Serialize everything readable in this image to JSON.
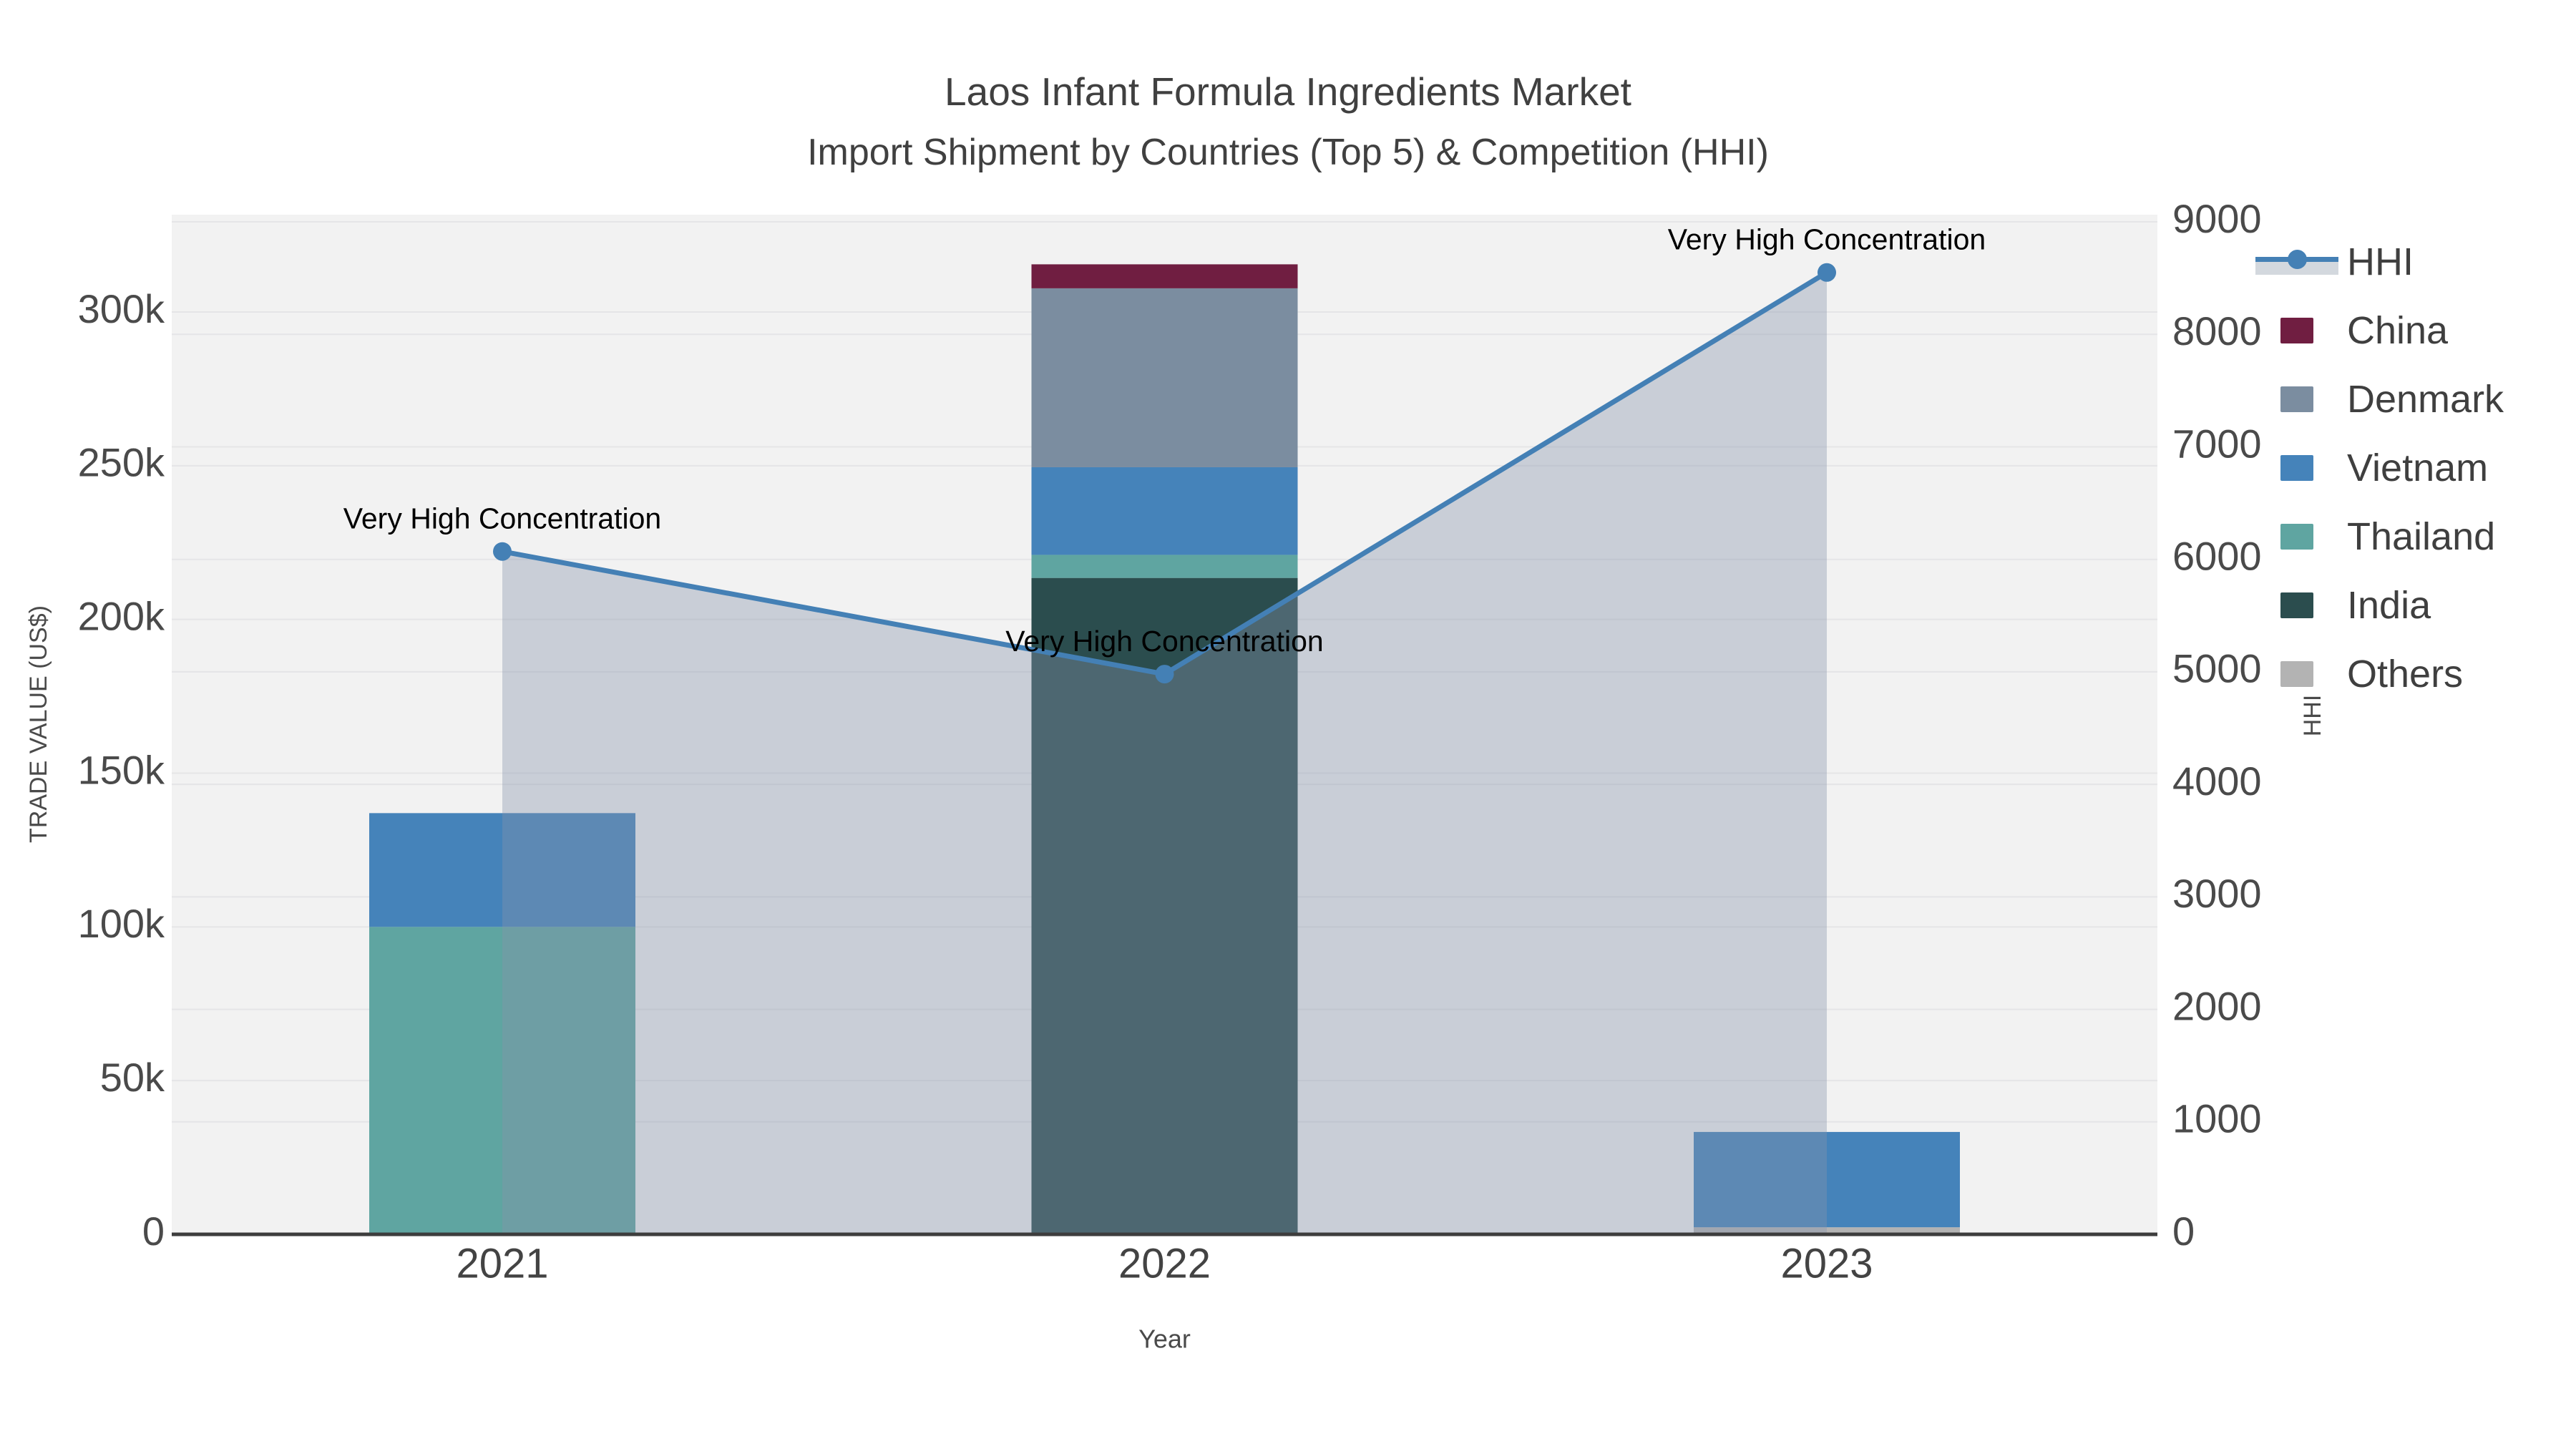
{
  "title": {
    "line1": "Laos Infant Formula Ingredients Market",
    "line2": "Import Shipment by Countries (Top 5) & Competition (HHI)"
  },
  "axes": {
    "x": {
      "label": "Year",
      "ticks": [
        "2021",
        "2022",
        "2023"
      ]
    },
    "y_left": {
      "label": "TRADE VALUE (US$)",
      "ticks": [
        "0",
        "50k",
        "100k",
        "150k",
        "200k",
        "250k",
        "300k"
      ],
      "tick_step": 50000
    },
    "y_right": {
      "label": "HHI",
      "ticks": [
        "0",
        "1000",
        "2000",
        "3000",
        "4000",
        "5000",
        "6000",
        "7000",
        "8000",
        "9000"
      ],
      "tick_step": 1000
    }
  },
  "legend": {
    "items": [
      {
        "label": "HHI",
        "type": "line",
        "color": "#4480b5",
        "band": "#d3d8de"
      },
      {
        "label": "China",
        "type": "bar",
        "color": "#701e41"
      },
      {
        "label": "Denmark",
        "type": "bar",
        "color": "#7b8da0"
      },
      {
        "label": "Vietnam",
        "type": "bar",
        "color": "#4583ba"
      },
      {
        "label": "Thailand",
        "type": "bar",
        "color": "#5fa5a1"
      },
      {
        "label": "India",
        "type": "bar",
        "color": "#2b4d4e"
      },
      {
        "label": "Others",
        "type": "bar",
        "color": "#b3b3b3"
      }
    ]
  },
  "chart_data": {
    "type": "combo",
    "subtype": "stacked-bar + line-area",
    "categories": [
      "2021",
      "2022",
      "2023"
    ],
    "bar_series": [
      {
        "name": "China",
        "color": "#701e41",
        "values": [
          0,
          7800,
          0
        ]
      },
      {
        "name": "Denmark",
        "color": "#7b8da0",
        "values": [
          0,
          58200,
          0
        ]
      },
      {
        "name": "Vietnam",
        "color": "#4583ba",
        "values": [
          37000,
          28500,
          31000
        ]
      },
      {
        "name": "Thailand",
        "color": "#5fa5a1",
        "values": [
          100000,
          7500,
          0
        ]
      },
      {
        "name": "India",
        "color": "#2b4d4e",
        "values": [
          0,
          213500,
          0
        ]
      },
      {
        "name": "Others",
        "color": "#b3b3b3",
        "values": [
          0,
          0,
          2300
        ]
      }
    ],
    "stack_order_bottom_to_top": [
      "Others",
      "India",
      "Thailand",
      "Vietnam",
      "Denmark",
      "China"
    ],
    "bar_totals": [
      137000,
      315500,
      33300
    ],
    "line_series": {
      "name": "HHI",
      "axis": "right",
      "color": "#4480b5",
      "area_fill": "rgba(134,148,172,0.38)",
      "values": [
        6070,
        4980,
        8550
      ]
    },
    "annotations": [
      {
        "text": "Very High Concentration",
        "category": "2021",
        "hhi": 6070
      },
      {
        "text": "Very High Concentration",
        "category": "2022",
        "hhi": 4980
      },
      {
        "text": "Very High Concentration",
        "category": "2023",
        "hhi": 8550
      }
    ],
    "y_left_range": [
      0,
      331650
    ],
    "y_right_range": [
      0,
      9064
    ],
    "grid": true,
    "legend_position": "top-right-outside",
    "title": "Laos Infant Formula Ingredients Market Import Shipment by Countries (Top 5) & Competition (HHI)",
    "xlabel": "Year",
    "ylabel_left": "TRADE VALUE (US$)",
    "ylabel_right": "HHI"
  },
  "colors": {
    "plot_background": "#f2f2f2",
    "figure_background": "#ffffff",
    "gridline": "#e5e5e7",
    "axis_line": "#3d3d3d",
    "tick_label": "#4a4a4a",
    "annotation_text": "#000000"
  }
}
